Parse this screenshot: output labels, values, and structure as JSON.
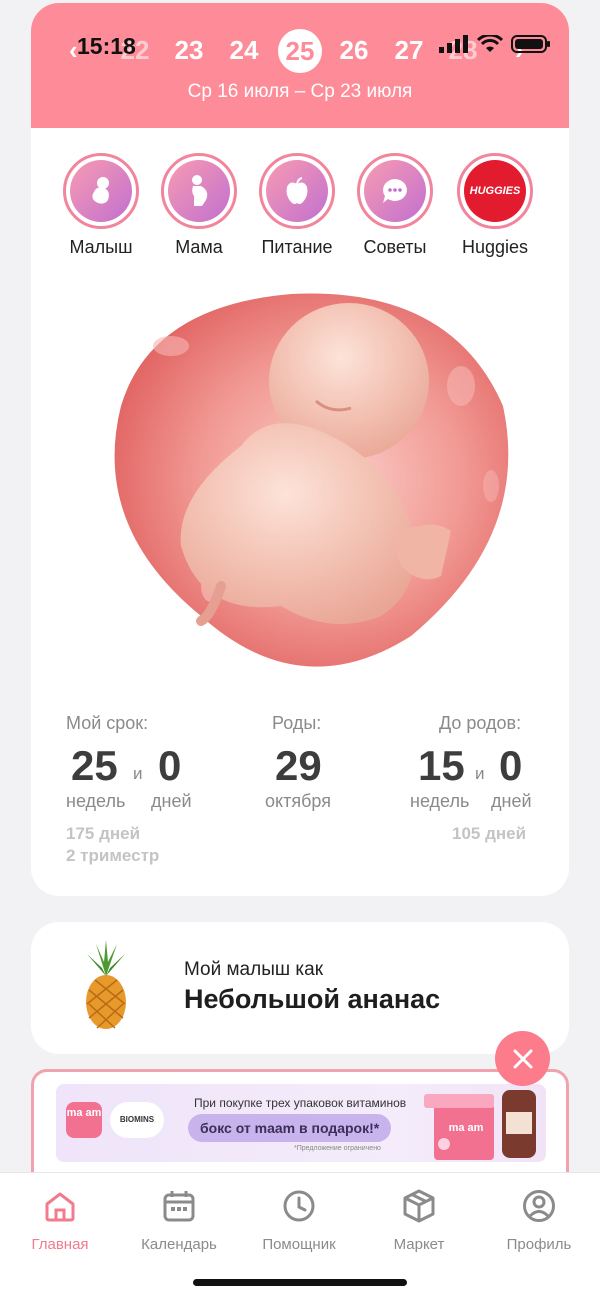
{
  "status_bar": {
    "time": "15:18"
  },
  "week_selector": {
    "weeks": [
      "22",
      "23",
      "24",
      "25",
      "26",
      "27",
      "28"
    ],
    "active": "25",
    "date_range": "Ср 16 июля – Ср 23 июля"
  },
  "stories": [
    {
      "label": "Малыш",
      "icon": "baby-icon"
    },
    {
      "label": "Мама",
      "icon": "mother-icon"
    },
    {
      "label": "Питание",
      "icon": "apple-icon"
    },
    {
      "label": "Советы",
      "icon": "chat-icon"
    },
    {
      "label": "Huggies",
      "logo": "HUGGIES"
    }
  ],
  "stats": {
    "term": {
      "label": "Мой срок:",
      "weeks": "25",
      "and": "и",
      "days": "0",
      "weeks_unit": "недель",
      "days_unit": "дней",
      "total_days": "175 дней",
      "trimester": "2 триместр"
    },
    "birth": {
      "label": "Роды:",
      "day": "29",
      "month": "октября"
    },
    "remaining": {
      "label": "До родов:",
      "weeks": "15",
      "and": "и",
      "days": "0",
      "weeks_unit": "недель",
      "days_unit": "дней",
      "total_days": "105 дней"
    }
  },
  "fruit": {
    "subtitle": "Мой малыш как",
    "title": "Небольшой ананас"
  },
  "ad": {
    "logo": "ma am",
    "brand": "BIOMINS",
    "line1": "При покупке трех упаковок витаминов",
    "highlight": "бокс от maam в подарок!*",
    "note": "*Предложение ограничено",
    "box_logo": "ma am"
  },
  "tabbar": [
    {
      "label": "Главная",
      "icon": "home-icon",
      "active": true
    },
    {
      "label": "Календарь",
      "icon": "calendar-icon"
    },
    {
      "label": "Помощник",
      "icon": "clock-icon"
    },
    {
      "label": "Маркет",
      "icon": "box-icon"
    },
    {
      "label": "Профиль",
      "icon": "profile-icon"
    }
  ],
  "colors": {
    "accent": "#fd8c98",
    "tab_active": "#f27b8c"
  }
}
